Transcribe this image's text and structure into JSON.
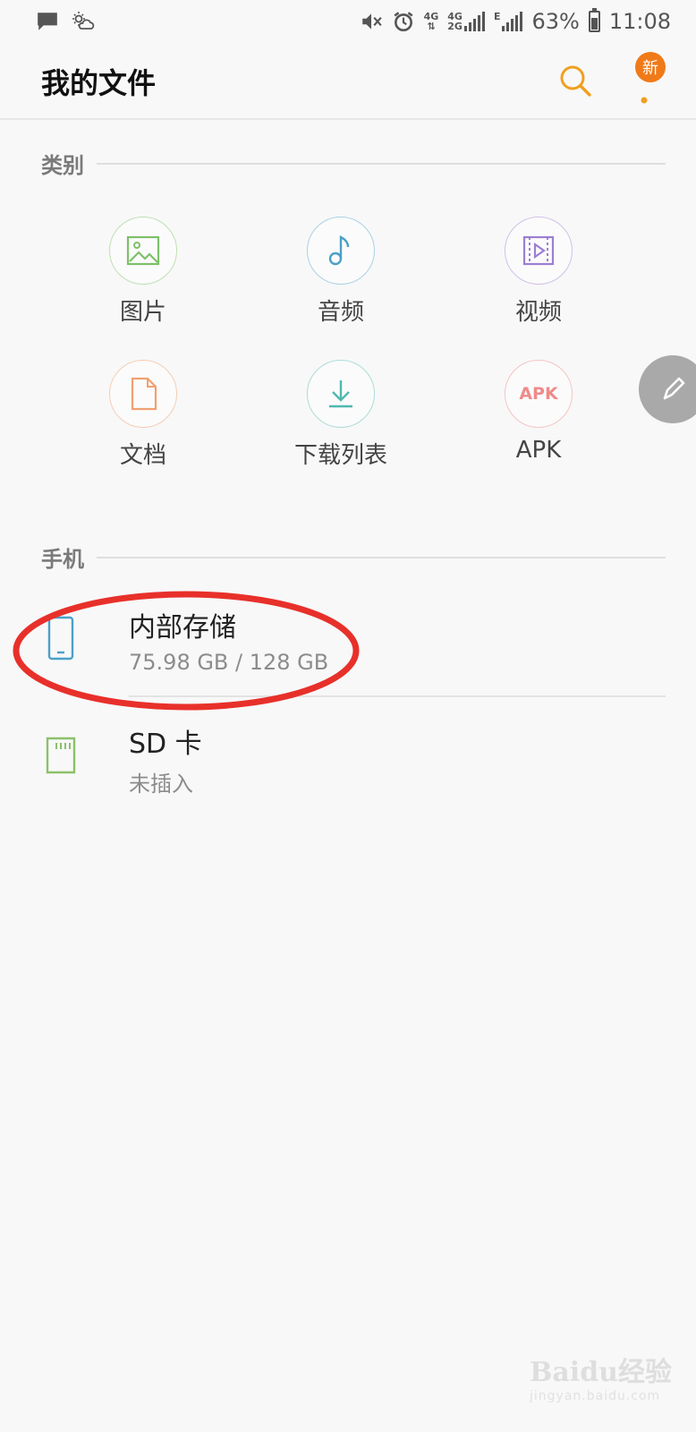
{
  "status_bar": {
    "network_1": "4G",
    "network_2_top": "4G",
    "network_2_bottom": "2G",
    "network_3": "E",
    "battery": "63%",
    "time": "11:08",
    "icons": [
      "message-icon",
      "weather-icon",
      "mute-icon",
      "alarm-icon",
      "signal-icon",
      "battery-icon"
    ]
  },
  "app_bar": {
    "title": "我的文件",
    "badge": "新",
    "accent": "#f07a18"
  },
  "categories": {
    "header": "类别",
    "items": [
      {
        "label": "图片",
        "icon": "image-icon",
        "color": "#7ec06a"
      },
      {
        "label": "音频",
        "icon": "music-note-icon",
        "color": "#4aa0c8"
      },
      {
        "label": "视频",
        "icon": "video-icon",
        "color": "#9b7fd4"
      },
      {
        "label": "文档",
        "icon": "document-icon",
        "color": "#f0a070"
      },
      {
        "label": "下载列表",
        "icon": "download-icon",
        "color": "#4fb8b0"
      },
      {
        "label": "APK",
        "icon": "apk-icon",
        "color": "#ef8a8a",
        "icon_text": "APK"
      }
    ]
  },
  "phone": {
    "header": "手机",
    "items": [
      {
        "title": "内部存储",
        "subtitle": "75.98 GB / 128 GB",
        "icon": "phone-storage-icon",
        "color": "#4aa0c8"
      },
      {
        "title": "SD 卡",
        "subtitle": "未插入",
        "icon": "sd-card-icon",
        "color": "#8cc06a"
      }
    ]
  },
  "annotation_color": "#e8302a",
  "watermark": {
    "main": "Baidu经验",
    "sub": "jingyan.baidu.com"
  }
}
